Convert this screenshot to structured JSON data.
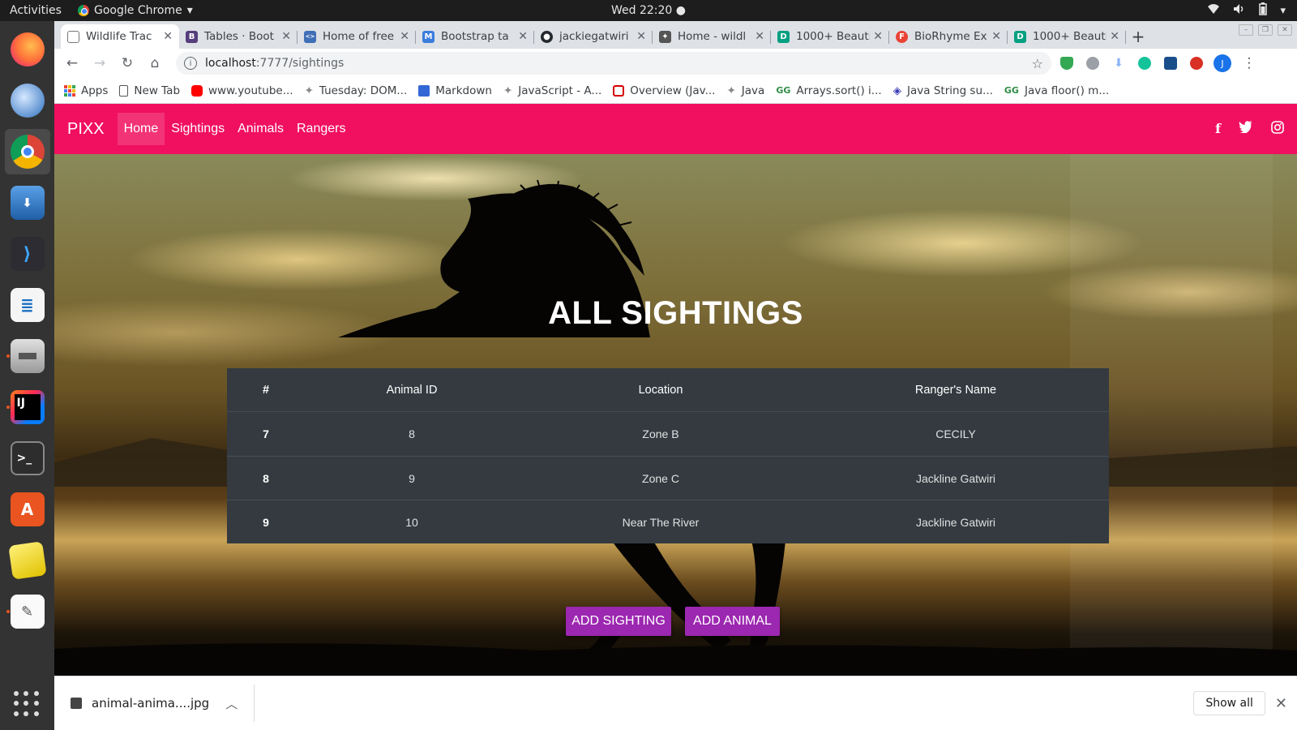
{
  "topbar": {
    "activities": "Activities",
    "app_name": "Google Chrome",
    "app_caret": "▾",
    "clock": "Wed 22:20 ●",
    "tray_icons": [
      "wifi-icon",
      "volume-icon",
      "battery-icon",
      "menu-caret-icon"
    ]
  },
  "dock": {
    "items": [
      "firefox",
      "thunderbird",
      "chrome",
      "transmission",
      "vscode",
      "libreoffice-writer",
      "files",
      "intellij",
      "terminal",
      "software",
      "stickies",
      "text-editor"
    ],
    "show_apps": "show-applications-icon"
  },
  "browser": {
    "tabs": [
      {
        "title": "Wildlife Trac",
        "favicon": "#ffffff",
        "active": true
      },
      {
        "title": "Tables · Boot",
        "favicon": "#563d7c",
        "letter": "B"
      },
      {
        "title": "Home of free",
        "favicon": "#3f6fb6",
        "letter": "<>"
      },
      {
        "title": "Bootstrap ta",
        "favicon": "#3b7ddd",
        "letter": "M"
      },
      {
        "title": "jackiegatwiri",
        "favicon": "#24292e",
        "letter": "●"
      },
      {
        "title": "Home - wildl",
        "favicon": "#555555",
        "letter": "✦"
      },
      {
        "title": "1000+ Beauti",
        "favicon": "#05a081",
        "letter": "D"
      },
      {
        "title": "BioRhyme Ex",
        "favicon": "#ea4335",
        "letter": "F"
      },
      {
        "title": "1000+ Beauti",
        "favicon": "#05a081",
        "letter": "D"
      }
    ],
    "new_tab": "+",
    "url_host": "localhost",
    "url_path": ":7777/sightings",
    "avatar_letter": "J",
    "bookmarks": [
      {
        "label": "Apps",
        "color": "#ea4335"
      },
      {
        "label": "New Tab",
        "color": "#ffffff"
      },
      {
        "label": "www.youtube...",
        "color": "#ff0000"
      },
      {
        "label": "Tuesday: DOM...",
        "color": "#888888"
      },
      {
        "label": "Markdown",
        "color": "#3367d6"
      },
      {
        "label": "JavaScript - A...",
        "color": "#888888"
      },
      {
        "label": "Overview (Jav...",
        "color": "#d50000"
      },
      {
        "label": "Java",
        "color": "#888888"
      },
      {
        "label": "Arrays.sort() i...",
        "color": "#2f8d46"
      },
      {
        "label": "Java String su...",
        "color": "#3b3bb3"
      },
      {
        "label": "Java floor() m...",
        "color": "#2f8d46"
      }
    ]
  },
  "site": {
    "brand": "PIXX",
    "nav": [
      "Home",
      "Sightings",
      "Animals",
      "Rangers"
    ],
    "social": [
      "f",
      "🐦",
      "◎"
    ],
    "heading": "ALL SIGHTINGS",
    "table": {
      "headers": [
        "#",
        "Animal ID",
        "Location",
        "Ranger's Name"
      ],
      "rows": [
        [
          "7",
          "8",
          "Zone B",
          "CECILY"
        ],
        [
          "8",
          "9",
          "Zone C",
          "Jackline Gatwiri"
        ],
        [
          "9",
          "10",
          "Near The River",
          "Jackline Gatwiri"
        ]
      ]
    },
    "buttons": {
      "add_sighting": "ADD SIGHTING",
      "add_animal": "ADD ANIMAL"
    },
    "colors": {
      "navbar": "#f0105f",
      "button": "#9c27b0",
      "table": "#343a40"
    }
  },
  "downloads": {
    "file": "animal-anima....jpg",
    "show_all": "Show all"
  }
}
